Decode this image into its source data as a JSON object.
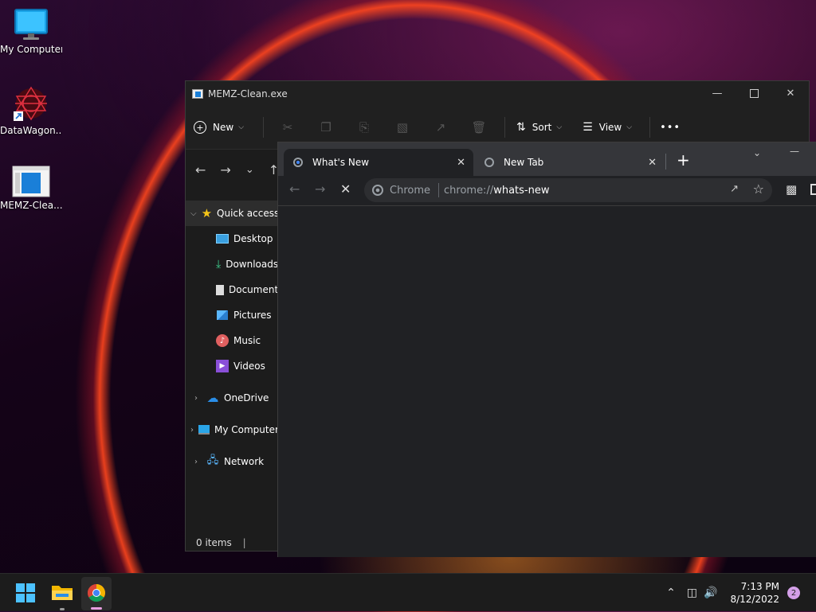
{
  "desktop": {
    "icons": [
      {
        "label": "My Computer"
      },
      {
        "label": "DataWagon..."
      },
      {
        "label": "MEMZ-Clea..."
      }
    ]
  },
  "explorer": {
    "title": "MEMZ-Clean.exe",
    "toolbar": {
      "new_label": "New",
      "sort_label": "Sort",
      "view_label": "View",
      "more_label": "•••"
    },
    "nav": {
      "back": "←",
      "forward": "→",
      "recent": "⌄",
      "up": "↑"
    },
    "tree": [
      {
        "label": "Quick access"
      },
      {
        "label": "Desktop"
      },
      {
        "label": "Downloads"
      },
      {
        "label": "Documents"
      },
      {
        "label": "Pictures"
      },
      {
        "label": "Music"
      },
      {
        "label": "Videos"
      },
      {
        "label": "OneDrive"
      },
      {
        "label": "My Computer"
      },
      {
        "label": "Network"
      }
    ],
    "status": "0 items"
  },
  "chrome": {
    "tabs": [
      {
        "label": "What's New"
      },
      {
        "label": "New Tab"
      }
    ],
    "new_tab": "+",
    "chip_label": "Chrome",
    "url_prefix": "chrome://",
    "url_host": "whats-new"
  },
  "taskbar": {
    "time": "7:13 PM",
    "date": "8/12/2022",
    "notification_count": "2"
  },
  "colors": {
    "accent": "#4cc2ff",
    "chrome_tabstrip": "#35363a",
    "chrome_bg": "#202124",
    "explorer_bg": "#1c1c1c"
  }
}
